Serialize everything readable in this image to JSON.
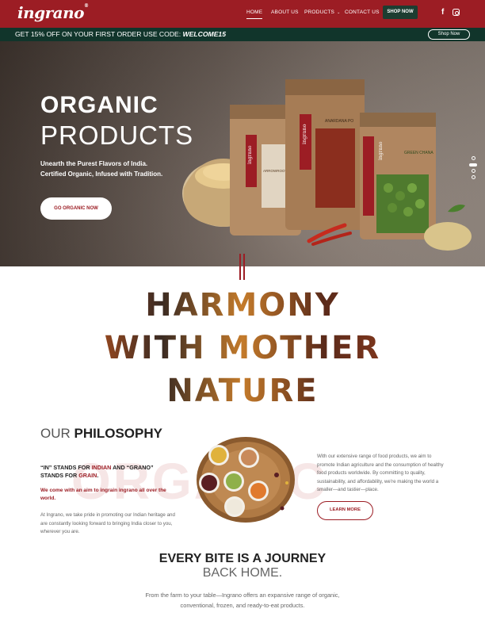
{
  "header": {
    "logo": "ingrano",
    "logo_mark": "®",
    "nav": [
      {
        "label": "HOME",
        "active": true
      },
      {
        "label": "ABOUT US",
        "active": false
      },
      {
        "label": "PRODUCTS",
        "active": false
      },
      {
        "label": "CONTACT US",
        "active": false
      }
    ],
    "products_caret": "⌄",
    "shop_label": "SHOP NOW",
    "social_icons": [
      "facebook-icon",
      "instagram-icon"
    ],
    "facebook_glyph": "f"
  },
  "promo": {
    "text": "GET 15% OFF ON YOUR FIRST ORDER USE CODE:",
    "code": "WELCOME15",
    "button_label": "Shop Now"
  },
  "hero": {
    "title_line1": "ORGANIC",
    "title_line2": "PRODUCTS",
    "subtitle_line1": "Unearth the Purest Flavors of India.",
    "subtitle_line2": "Certified Organic, Infused with Tradition.",
    "cta": "GO ORGANIC NOW",
    "packages": [
      {
        "brand": "ingrano",
        "name": "ARROWROOT FLOUR"
      },
      {
        "brand": "ingrano",
        "name": "ANARDANA PO"
      },
      {
        "brand": "ingrano",
        "name": "GREEN CHANA"
      }
    ],
    "slider_dots": 4,
    "active_slide": 2
  },
  "harmony": {
    "line1": "HARMONY",
    "line2": "WITH MOTHER",
    "line3": "NATURE"
  },
  "philosophy": {
    "title_light": "OUR",
    "title_bold": "PHILOSOPHY",
    "watermark": "ORGANIC",
    "in_grano_pre": "“IN” STANDS FOR",
    "in_grano_indian": "INDIAN",
    "in_grano_and": "AND “GRANO” STANDS FOR",
    "in_grano_grain": "GRAIN",
    "in_grano_end": ".",
    "mission": "We come with an aim to ingrain ingrano all over the world.",
    "paragraph_left": "At Ingrano, we take pride in promoting our Indian heritage and are constantly looking forward to bringing India closer to you, wherever you are.",
    "paragraph_right": "With our extensive range of food products, we aim to promote Indian agriculture and the consumption of healthy food products worldwide. By committing to quality, sustainability, and affordability, we're making the world a smaller—and tastier—place.",
    "learn_more": "LEARN MORE"
  },
  "journey": {
    "title_bold": "EVERY BITE IS A JOURNEY",
    "title_light": "BACK HOME.",
    "text": "From the farm to your table—Ingrano offers an expansive range of organic, conventional, frozen, and ready-to-eat products."
  },
  "colors": {
    "brand_red": "#9c1d24",
    "dark_green": "#11352b",
    "button_green": "#1c3d31"
  }
}
